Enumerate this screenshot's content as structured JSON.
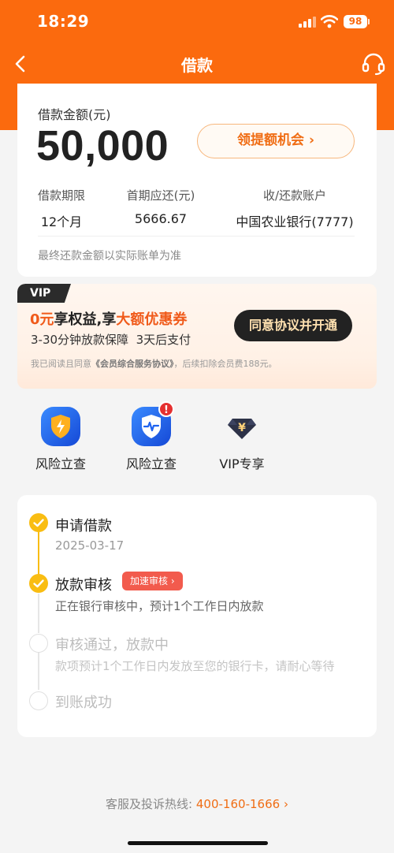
{
  "status_bar": {
    "time": "18:29",
    "battery": "98"
  },
  "nav": {
    "title": "借款",
    "back_icon": "chevron-left-icon",
    "service_icon": "headset-icon"
  },
  "loan": {
    "amount_label": "借款金额(元)",
    "amount": "50,000",
    "boost_button": "领提额机会 ›",
    "term_label": "借款期限",
    "term_value": "12个月",
    "first_payment_label": "首期应还(元)",
    "first_payment_value": "5666.67",
    "account_label": "收/还款账户",
    "account_value": "中国农业银行(7777)",
    "note": "最终还款金额以实际账单为准"
  },
  "vip": {
    "badge": "VIP",
    "title_prefix": "0元",
    "title_mid": "享权益,享",
    "title_highlight": "大额优惠券",
    "subtitle": "3-30分钟放款保障  3天后支付",
    "agree_button": "同意协议并开通",
    "agreement_prefix": "我已阅读且同意",
    "agreement_link": "《会员综合服务协议》",
    "agreement_suffix": "，后续扣除会员费188元。",
    "colors": {
      "highlight": "#f05a1a",
      "button_bg": "#222222",
      "button_text": "#ffe1b0"
    }
  },
  "services": [
    {
      "label": "风险立查",
      "icon": "shield-lightning-icon"
    },
    {
      "label": "风险立查",
      "icon": "shield-pulse-icon",
      "badge": "!"
    },
    {
      "label": "VIP专享",
      "icon": "yen-diamond-icon"
    }
  ],
  "progress": {
    "steps": [
      {
        "title": "申请借款",
        "desc": "2025-03-17",
        "status": "done"
      },
      {
        "title": "放款审核",
        "desc": "正在银行审核中，预计1个工作日内放款",
        "status": "done",
        "tag": "加速审核 ›"
      },
      {
        "title": "审核通过，放款中",
        "desc": "款项预计1个工作日内发放至您的银行卡，请耐心等待",
        "status": "pending"
      },
      {
        "title": "到账成功",
        "status": "pending"
      }
    ]
  },
  "footer": {
    "hotline_label": "客服及投诉热线:",
    "hotline_number": "400-160-1666",
    "arrow": "›"
  },
  "colors": {
    "brand": "#fb6a0e",
    "progress": "#f9bd12",
    "tag": "#f25b4d"
  }
}
